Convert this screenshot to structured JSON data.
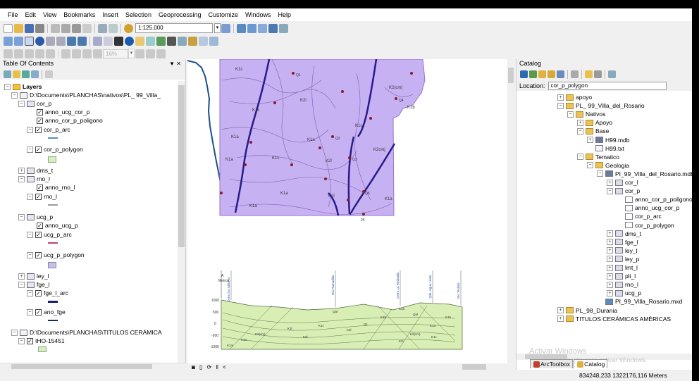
{
  "menu": [
    "File",
    "Edit",
    "View",
    "Bookmarks",
    "Insert",
    "Selection",
    "Geoprocessing",
    "Customize",
    "Windows",
    "Help"
  ],
  "toolbar": {
    "scale": "1:125.000",
    "zoom": "16%"
  },
  "toc": {
    "title": "Table Of Contents",
    "pin": "▼ ✕",
    "layers_label": "Layers",
    "items": [
      "D:\\Documents\\PLANCHAS\\nativos\\PL_ 99_Villa_",
      "cor_p",
      "anno_ucg_cor_p",
      "anno_cor_p_poligono",
      "cor_p_arc",
      "cor_p_polygon",
      "dms_t",
      "rno_l",
      "anno_rno_l",
      "rno_l",
      "ucg_p",
      "anno_ucg_p",
      "ucg_p_arc",
      "ucg_p_polygon",
      "ley_l",
      "fge_l",
      "fge_l_arc",
      "ano_fge",
      "D:\\Documents\\PLANCHAS\\TITULOS CERÁMICA",
      "IHO-15451"
    ]
  },
  "map": {
    "polygon_labels": [
      "K1c",
      "K1a",
      "K1a",
      "K1c",
      "K2(cm)",
      "K1c",
      "K2cmj",
      "K2l",
      "K1a",
      "K1a",
      "K1c",
      "K1a",
      "K1a",
      "K2l",
      "K1b",
      "K2l"
    ],
    "point_labels": [
      "Q1",
      "Q2",
      "Q3",
      "Q4",
      "Q5",
      "25"
    ],
    "section": {
      "left_axis": [
        "A",
        "Metros"
      ],
      "y_ticks": [
        "1000",
        "500",
        "0",
        "-500",
        "-1000"
      ],
      "top_labels": [
        "Cerro los Isidoros",
        "Río Ramadilla",
        "Cerro La Redonda",
        "Qda. Agua Linda",
        "Río Techira"
      ],
      "unit_labels": [
        "Qal",
        "K1a",
        "K1b",
        "K2(cm)",
        "K2l",
        "K1c",
        "K1a",
        "K2l",
        "Qal",
        "K1a",
        "K1b",
        "K2(cm)",
        "K1c",
        "K2l",
        "K2l",
        "Q1",
        "K1m"
      ]
    }
  },
  "map_bottom": "◙ ▯ ⟳ ‖ <",
  "catalog": {
    "title": "Catalog",
    "location_label": "Location:",
    "location_value": "cor_p_polygon",
    "items": [
      {
        "label": "apoyo",
        "type": "folder",
        "indent": 0,
        "exp": "+"
      },
      {
        "label": "PL_ 99_Villa_del_Rosario",
        "type": "folder",
        "indent": 0,
        "exp": "-"
      },
      {
        "label": "Nativos",
        "type": "folder",
        "indent": 1,
        "exp": "-"
      },
      {
        "label": "Apoyo",
        "type": "folder",
        "indent": 2,
        "exp": "+"
      },
      {
        "label": "Base",
        "type": "folder",
        "indent": 2,
        "exp": "-"
      },
      {
        "label": "H99.mdb",
        "type": "db",
        "indent": 3,
        "exp": "+"
      },
      {
        "label": "H99.txt",
        "type": "file",
        "indent": 3,
        "exp": ""
      },
      {
        "label": "Tematico",
        "type": "folder",
        "indent": 2,
        "exp": "-"
      },
      {
        "label": "Geologia",
        "type": "folder",
        "indent": 3,
        "exp": "-"
      },
      {
        "label": "PI_99_Villa_del_Rosario.mdb",
        "type": "db",
        "indent": 4,
        "exp": "-"
      },
      {
        "label": "cor_l",
        "type": "fds",
        "indent": 5,
        "exp": "+"
      },
      {
        "label": "cor_p",
        "type": "fds",
        "indent": 5,
        "exp": "-"
      },
      {
        "label": "anno_cor_p_poligono",
        "type": "anno",
        "indent": 6,
        "exp": ""
      },
      {
        "label": "anno_ucg_cor_p",
        "type": "anno",
        "indent": 6,
        "exp": ""
      },
      {
        "label": "cor_p_arc",
        "type": "line",
        "indent": 6,
        "exp": ""
      },
      {
        "label": "cor_p_polygon",
        "type": "poly",
        "indent": 6,
        "exp": ""
      },
      {
        "label": "dms_t",
        "type": "fds",
        "indent": 5,
        "exp": "+"
      },
      {
        "label": "fge_l",
        "type": "fds",
        "indent": 5,
        "exp": "+"
      },
      {
        "label": "ley_l",
        "type": "fds",
        "indent": 5,
        "exp": "+"
      },
      {
        "label": "ley_p",
        "type": "fds",
        "indent": 5,
        "exp": "+"
      },
      {
        "label": "lmt_l",
        "type": "fds",
        "indent": 5,
        "exp": "+"
      },
      {
        "label": "pli_l",
        "type": "fds",
        "indent": 5,
        "exp": "+"
      },
      {
        "label": "rno_l",
        "type": "fds",
        "indent": 5,
        "exp": "+"
      },
      {
        "label": "ucg_p",
        "type": "fds",
        "indent": 5,
        "exp": "+"
      },
      {
        "label": "PI_99_Villa_Rosario.mxd",
        "type": "mxd",
        "indent": 4,
        "exp": ""
      },
      {
        "label": "PL_98_Durania",
        "type": "folder",
        "indent": 0,
        "exp": "+"
      },
      {
        "label": "TITULOS CERÁMICAS AMÉRICAS",
        "type": "folder",
        "indent": 0,
        "exp": "+"
      }
    ],
    "tabs": [
      "ArcToolbox",
      "Catalog"
    ]
  },
  "status": {
    "coords": "834248,233  1322176,116 Meters"
  },
  "watermark": {
    "title": "Activar Windows",
    "subtitle": "Ve a Configuración para activar Windows."
  },
  "colors": {
    "polygon_fill": "#c6b2f2",
    "section_fill": "#d8eeb5",
    "river": "#1a4f8a",
    "fault": "#2a1a8a"
  }
}
